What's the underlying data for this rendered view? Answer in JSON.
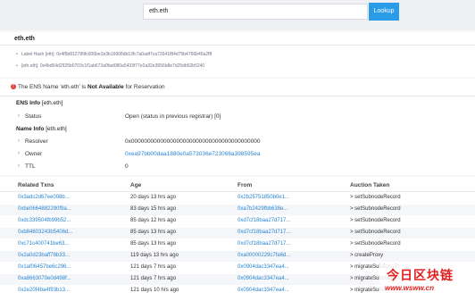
{
  "search": {
    "value": "eth.eth",
    "button_label": "Lookup"
  },
  "domain_card": {
    "title": "eth.eth",
    "label_hash": "Label Hash [eth]: 0x4f5b812789fc606be1b3b16908db13fc7a0adf7ca72641f84d75b4766b45a2f8",
    "namehash": "[eth.eth]: 0x4bd54d2925b0703c1f1ab673a0fad080a5433f77e2a32e3656b8e7d25db52b5240"
  },
  "notice": {
    "icon": "!",
    "prefix": "The ENS Name 'eth.eth' is",
    "strong": "Not Available",
    "suffix": "for Reservation"
  },
  "ens_info": {
    "title": "ENS Info",
    "title_suffix": "[eth.eth]",
    "status_label": "Status",
    "status_value": "Open (status in previous registrar) [0]"
  },
  "name_info": {
    "title": "Name Info",
    "title_suffix": "[eth.eth]",
    "resolver_label": "Resolver",
    "resolver_value": "0x0000000000000000000000000000000000000000",
    "owner_label": "Owner",
    "owner_value": "0xea97bb00daa1880e0a573036e723066a398595ea",
    "ttl_label": "TTL",
    "ttl_value": "0"
  },
  "transactions": {
    "headers": [
      "Related Txns",
      "Age",
      "From",
      "Auction Taken"
    ],
    "rows": [
      {
        "txn": "0x3adc2d67ee008b...",
        "age": "20 days 13 hrs ago",
        "from": "0x2b25751850b0e1...",
        "action": "> setSubnodeRecord"
      },
      {
        "txn": "0xbe0664882290f9a...",
        "age": "83 days 15 hrs ago",
        "from": "0xa7b2429fbb638e...",
        "action": "> setSubnodeRecord"
      },
      {
        "txn": "0xdc339504fb99b52...",
        "age": "85 days 12 hrs ago",
        "from": "0xd7cf18baa27d717...",
        "action": "> setSubnodeRecord"
      },
      {
        "txn": "0xb84603243b5406d...",
        "age": "85 days 13 hrs ago",
        "from": "0xd7cf18baa27d717...",
        "action": "> setSubnodeRecord"
      },
      {
        "txn": "0xc71c400741be63...",
        "age": "85 days 13 hrs ago",
        "from": "0xd7cf18baa27d717...",
        "action": "> setSubnodeRecord"
      },
      {
        "txn": "0x2a0d23baff78b33...",
        "age": "119 days 13 hrs ago",
        "from": "0xa00000229c7fa6d...",
        "action": "> createProxy"
      },
      {
        "txn": "0x1af06457be6c296...",
        "age": "121 days 7 hrs ago",
        "from": "0x0904dac3347ea4...",
        "action": "> migrateSubdomain"
      },
      {
        "txn": "0xa8663070e0d498f...",
        "age": "121 days 7 hrs ago",
        "from": "0x0904dac3347ea4...",
        "action": "> migrateSubdomain"
      },
      {
        "txn": "0x2e20f4ba4f93b13...",
        "age": "121 days 10 hrs ago",
        "from": "0x0904dac3347ea4...",
        "action": "> migrateSubdomain"
      }
    ]
  },
  "watermark": {
    "logo_text": "今日区块链",
    "url_text": "www.wsww.cn"
  }
}
